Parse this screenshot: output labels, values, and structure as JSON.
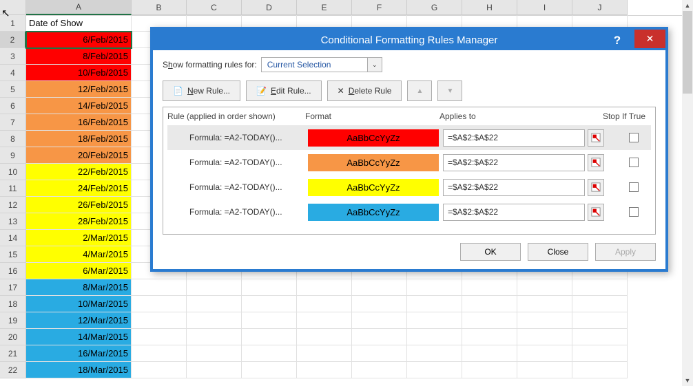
{
  "columns": [
    "A",
    "B",
    "C",
    "D",
    "E",
    "F",
    "G",
    "H",
    "I",
    "J"
  ],
  "active_column": "A",
  "active_row": 2,
  "header_cell": "Date of Show",
  "cells": [
    {
      "row": 2,
      "text": "6/Feb/2015",
      "bg": "#ff0000"
    },
    {
      "row": 3,
      "text": "8/Feb/2015",
      "bg": "#ff0000"
    },
    {
      "row": 4,
      "text": "10/Feb/2015",
      "bg": "#ff0000"
    },
    {
      "row": 5,
      "text": "12/Feb/2015",
      "bg": "#f79646"
    },
    {
      "row": 6,
      "text": "14/Feb/2015",
      "bg": "#f79646"
    },
    {
      "row": 7,
      "text": "16/Feb/2015",
      "bg": "#f79646"
    },
    {
      "row": 8,
      "text": "18/Feb/2015",
      "bg": "#f79646"
    },
    {
      "row": 9,
      "text": "20/Feb/2015",
      "bg": "#f79646"
    },
    {
      "row": 10,
      "text": "22/Feb/2015",
      "bg": "#ffff00"
    },
    {
      "row": 11,
      "text": "24/Feb/2015",
      "bg": "#ffff00"
    },
    {
      "row": 12,
      "text": "26/Feb/2015",
      "bg": "#ffff00"
    },
    {
      "row": 13,
      "text": "28/Feb/2015",
      "bg": "#ffff00"
    },
    {
      "row": 14,
      "text": "2/Mar/2015",
      "bg": "#ffff00"
    },
    {
      "row": 15,
      "text": "4/Mar/2015",
      "bg": "#ffff00"
    },
    {
      "row": 16,
      "text": "6/Mar/2015",
      "bg": "#ffff00"
    },
    {
      "row": 17,
      "text": "8/Mar/2015",
      "bg": "#29abe2"
    },
    {
      "row": 18,
      "text": "10/Mar/2015",
      "bg": "#29abe2"
    },
    {
      "row": 19,
      "text": "12/Mar/2015",
      "bg": "#29abe2"
    },
    {
      "row": 20,
      "text": "14/Mar/2015",
      "bg": "#29abe2"
    },
    {
      "row": 21,
      "text": "16/Mar/2015",
      "bg": "#29abe2"
    },
    {
      "row": 22,
      "text": "18/Mar/2015",
      "bg": "#29abe2"
    }
  ],
  "dialog": {
    "title": "Conditional Formatting Rules Manager",
    "filter_label": "Show formatting rules for:",
    "filter_value": "Current Selection",
    "btn_new": "New Rule...",
    "btn_edit": "Edit Rule...",
    "btn_delete": "Delete Rule",
    "head_rule": "Rule (applied in order shown)",
    "head_format": "Format",
    "head_applies": "Applies to",
    "head_stop": "Stop If True",
    "preview_text": "AaBbCcYyZz",
    "rules": [
      {
        "formula": "Formula: =A2-TODAY()...",
        "bg": "#ff0000",
        "color": "#000000",
        "applies": "=$A$2:$A$22",
        "selected": true
      },
      {
        "formula": "Formula: =A2-TODAY()...",
        "bg": "#f79646",
        "color": "#000000",
        "applies": "=$A$2:$A$22",
        "selected": false
      },
      {
        "formula": "Formula: =A2-TODAY()...",
        "bg": "#ffff00",
        "color": "#000000",
        "applies": "=$A$2:$A$22",
        "selected": false
      },
      {
        "formula": "Formula: =A2-TODAY()...",
        "bg": "#29abe2",
        "color": "#000000",
        "applies": "=$A$2:$A$22",
        "selected": false
      }
    ],
    "btn_ok": "OK",
    "btn_close": "Close",
    "btn_apply": "Apply"
  }
}
